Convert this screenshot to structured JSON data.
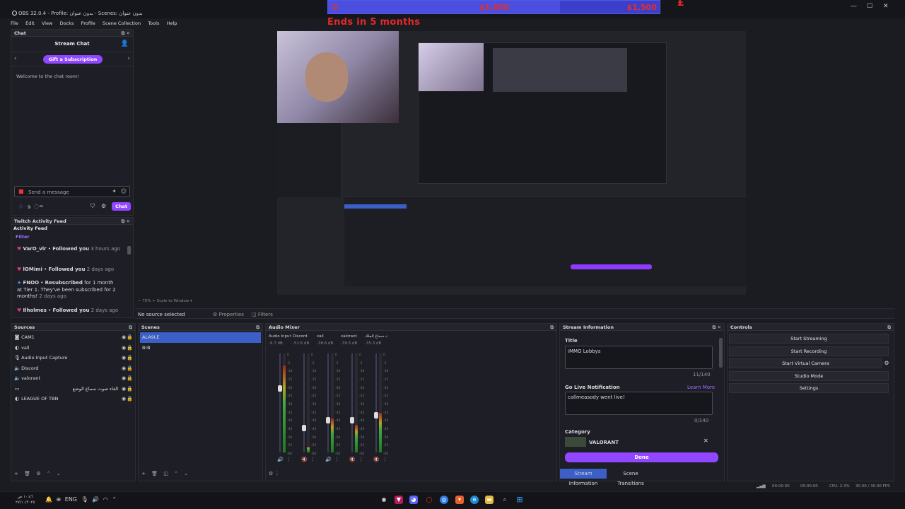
{
  "window": {
    "title": "OBS 32.0.4 - Profile: بدون عنوان - Scenes: بدون عنوان",
    "min": "—",
    "max": "☐",
    "close": "✕"
  },
  "goal": {
    "start": "0",
    "current": "$1,050",
    "target": "$1,500",
    "progress": 0.7,
    "ends": "Ends in 5 months",
    "overflow_mark": "£"
  },
  "menu": [
    "File",
    "Edit",
    "View",
    "Docks",
    "Profile",
    "Scene Collection",
    "Tools",
    "Help"
  ],
  "chat": {
    "dock_title": "Chat",
    "header": "Stream Chat",
    "gift_button": "Gift a Subscription",
    "welcome": "Welcome to the chat room!",
    "input_placeholder": "Send a message",
    "points": "9",
    "chat_button": "Chat"
  },
  "activity": {
    "dock_title": "Twitch Activity Feed",
    "header": "Activity Feed",
    "filter": "Filter",
    "items": [
      {
        "user": "VarO_vlr",
        "action": "Followed you",
        "time": "3 hours ago",
        "extra": ""
      },
      {
        "user": "lOMimi",
        "action": "Followed you",
        "time": "2 days ago",
        "extra": ""
      },
      {
        "user": "FNOO",
        "action": "Resubscribed",
        "time": "2 days ago",
        "extra": "for 1 month at Tier 1. They've been subscribed for 2 months!"
      },
      {
        "user": "Ilholmes",
        "action": "Followed you",
        "time": "2 days ago",
        "extra": ""
      }
    ]
  },
  "preview_bottom": {
    "zoom": "70%",
    "scale": "Scale to Window"
  },
  "toolbar": {
    "no_source": "No source selected",
    "properties": "Properties",
    "filters": "Filters"
  },
  "sources": {
    "title": "Sources",
    "items": [
      "CAM1",
      "vall",
      "Audio Input Capture",
      "Discord",
      "valorant",
      "الغاء صوت سماع الوضع",
      "LEAGUE OF TBN"
    ]
  },
  "scenes": {
    "title": "Scenes",
    "items": [
      "ALA9LE",
      "BrB"
    ]
  },
  "mixer": {
    "title": "Audio Mixer",
    "channels": [
      {
        "name": "Audio Input Captur",
        "db": "-9.7 dB",
        "level": 0.88,
        "fader": 0.65
      },
      {
        "name": "Discord",
        "db": "-52.6 dB",
        "level": 0.06,
        "fader": 0.25
      },
      {
        "name": "vall",
        "db": "-38.6 dB",
        "level": 0.34,
        "fader": 0.33
      },
      {
        "name": "valorant",
        "db": "-39.5 dB",
        "level": 0.28,
        "fader": 0.33
      },
      {
        "name": "صوت سماع الملك",
        "db": "-35.3 dB",
        "level": 0.4,
        "fader": 0.38
      }
    ],
    "scale": [
      "0",
      "-5",
      "-10",
      "-15",
      "-20",
      "-25",
      "-30",
      "-35",
      "-40",
      "-45",
      "-50",
      "-55",
      "-60"
    ]
  },
  "stream_info": {
    "title_label": "Stream Information",
    "field_title": "Title",
    "title_value": "iMMO Lobbys",
    "title_count": "11/140",
    "golive_label": "Go Live Notification",
    "learn_more": "Learn More",
    "golive_value": "callmeasody went live!",
    "golive_count": "0/140",
    "category_label": "Category",
    "category_value": "VALORANT",
    "done": "Done",
    "tab_info": "Stream Information",
    "tab_transitions": "Scene Transitions"
  },
  "controls": {
    "title": "Controls",
    "buttons": [
      "Start Streaming",
      "Start Recording",
      "Start Virtual Camera",
      "Studio Mode",
      "Settings"
    ]
  },
  "statusbar": {
    "stream_time": "00:00:00",
    "rec_time": "00:00:00",
    "cpu": "CPU: 2.3%",
    "fps": "30.00 / 30.00 FPS"
  },
  "taskbar": {
    "lang": "ENG",
    "time": "١٠:٤٦ ص",
    "date": "٢٧/١٠/٢٠٢٥"
  },
  "colors": {
    "accent": "#9147ff",
    "scene_selected": "#3b5fc6",
    "goal": "#3c3fc9",
    "goal_text": "#e52d2d"
  }
}
